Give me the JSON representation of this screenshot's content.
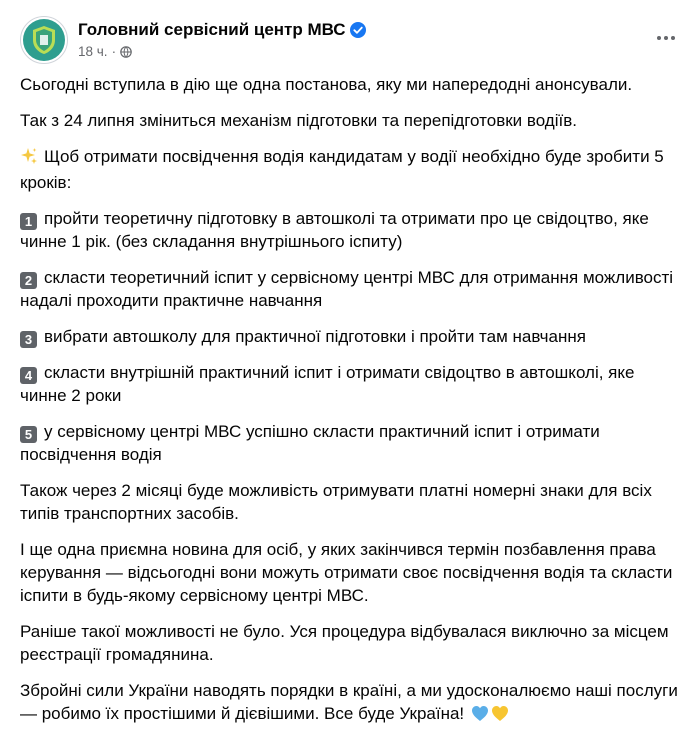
{
  "post": {
    "page_name": "Головний сервісний центр МВС",
    "timestamp": "18 ч.",
    "separator": "·"
  },
  "content": {
    "p1": "Сьогодні вступила в дію ще одна постанова, яку ми напередодні анонсували.",
    "p2": "Так з 24 липня зміниться механізм підготовки та перепідготовки водіїв.",
    "p3": "Щоб отримати посвідчення водія кандидатам у водії необхідно буде зробити 5 кроків:",
    "steps": [
      {
        "num": "1",
        "text": "пройти теоретичну підготовку в автошколі та отримати про це свідоцтво, яке чинне 1 рік. (без складання внутрішнього іспиту)"
      },
      {
        "num": "2",
        "text": "скласти теоретичний іспит у сервісному центрі МВС для отримання можливості надалі проходити практичне навчання"
      },
      {
        "num": "3",
        "text": "вибрати автошколу для практичної підготовки і пройти там навчання"
      },
      {
        "num": "4",
        "text": "скласти внутрішній практичний іспит і отримати свідоцтво в автошколі, яке чинне 2 роки"
      },
      {
        "num": "5",
        "text": "у сервісному центрі МВС успішно скласти практичний іспит і отримати посвідчення водія"
      }
    ],
    "p4": "Також через 2 місяці буде можливість отримувати платні номерні знаки для всіх типів транспортних засобів.",
    "p5": "І ще одна приємна новина для осіб, у яких закінчився термін позбавлення права керування — відсьогодні вони можуть отримати своє посвідчення водія та скласти іспити в будь-якому сервісному центрі МВС.",
    "p6": "Раніше такої можливості не було. Уся процедура відбувалася виключно за місцем реєстрації громадянина.",
    "p7": "Збройні сили України наводять порядки в країні, а ми удосконалюємо наші послуги — робимо їх простішими й дієвішими. Все буде Україна!"
  },
  "icons": {
    "verified": "verified-badge-icon",
    "audience": "globe-icon",
    "sparkle": "sparkles-icon",
    "hearts": [
      "blue-heart-icon",
      "yellow-heart-icon"
    ]
  },
  "colors": {
    "verified_blue": "#1877f2",
    "secondary_text": "#65676b",
    "badge_gray": "#5f6368",
    "heart_blue": "#5aaee8",
    "heart_yellow": "#f7c531"
  }
}
